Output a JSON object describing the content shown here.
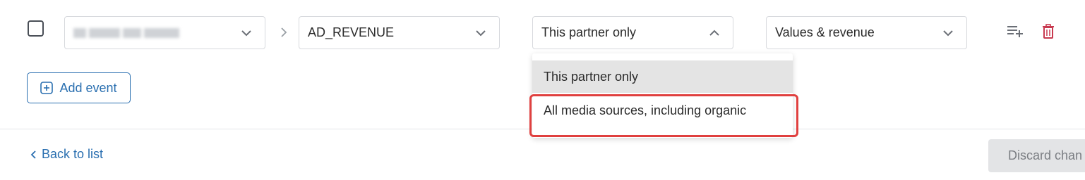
{
  "row": {
    "event_select": {
      "value_hidden": true
    },
    "event_name_select": {
      "value": "AD_REVENUE"
    },
    "attribution_select": {
      "value": "This partner only",
      "open": true
    },
    "sending_option_select": {
      "value": "Values & revenue"
    }
  },
  "dropdown": {
    "options": [
      "This partner only",
      "All media sources, including organic"
    ],
    "selected_index": 0,
    "highlighted_index": 1
  },
  "actions": {
    "add_event_label": "Add event",
    "back_label": "Back to list",
    "discard_label": "Discard chan"
  },
  "colors": {
    "accent_blue": "#2a6fb0",
    "delete_red": "#c8394f",
    "highlight_red": "#e0403f",
    "border_gray": "#d7d9dd"
  },
  "icons": {
    "chevron": "chevron-down-icon",
    "chevron_up": "chevron-up-icon",
    "add_row": "playlist-add-icon",
    "delete": "trash-icon",
    "separator": "chevron-right-icon",
    "plus_box": "plus-square-icon",
    "back": "chevron-left-icon"
  }
}
